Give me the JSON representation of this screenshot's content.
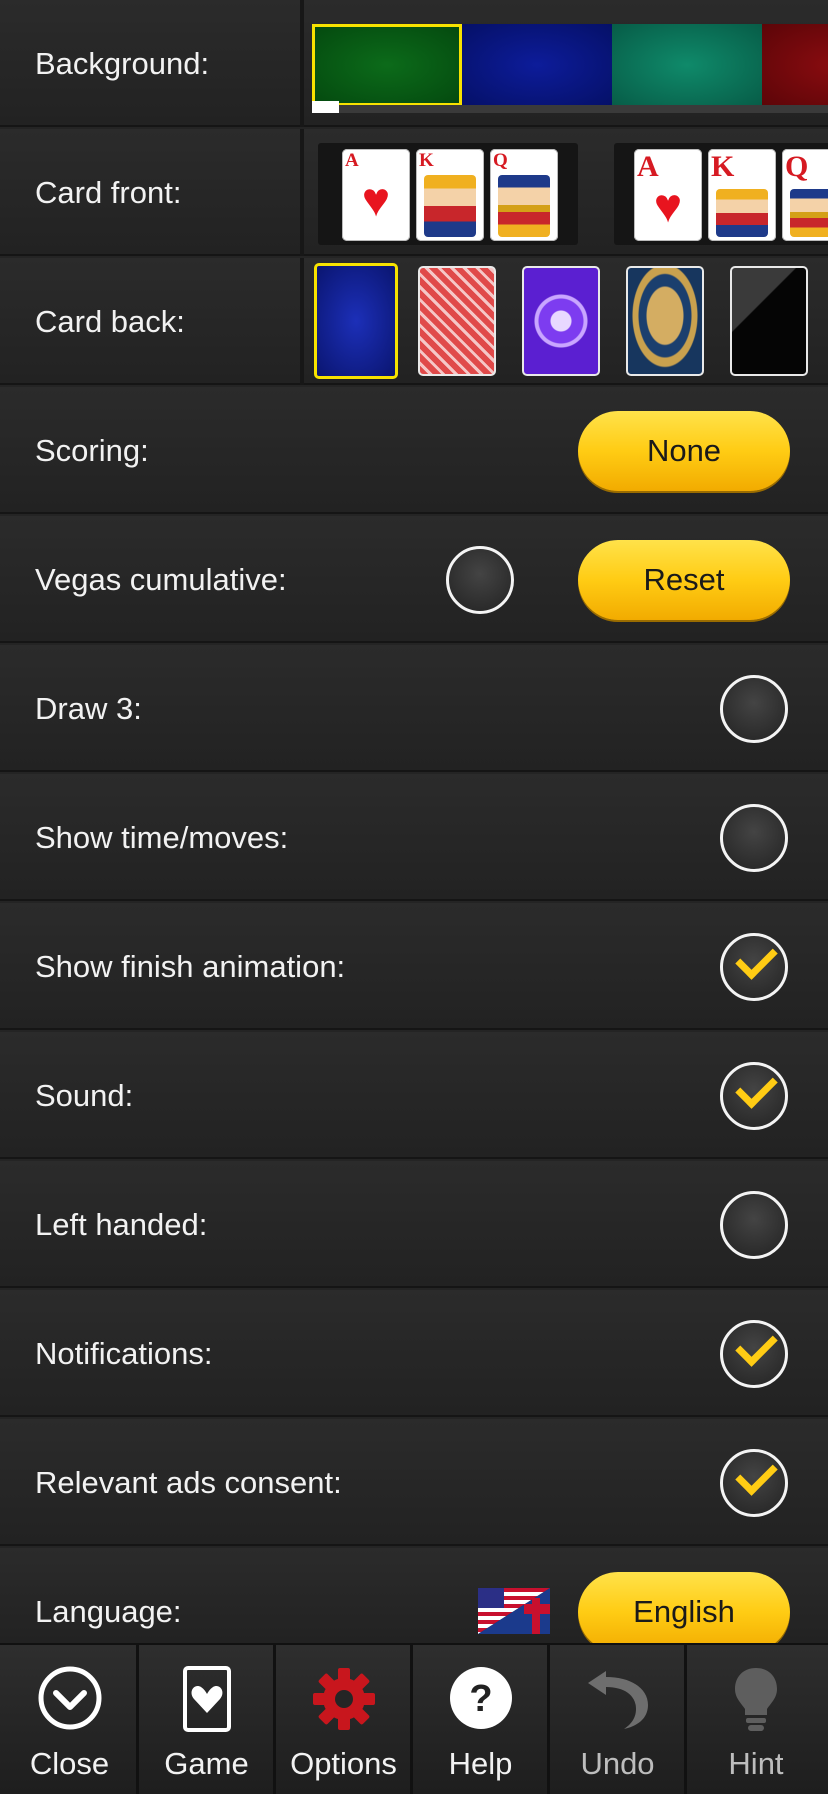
{
  "settings": {
    "background": {
      "label": "Background:",
      "colors": [
        "#0c6b1a",
        "#0d1c9a",
        "#0f8a6a",
        "#8a0c10"
      ]
    },
    "card_front": {
      "label": "Card front:",
      "ranks": [
        "A",
        "K",
        "Q"
      ]
    },
    "card_back": {
      "label": "Card back:"
    },
    "scoring": {
      "label": "Scoring:",
      "button": "None"
    },
    "vegas": {
      "label": "Vegas cumulative:",
      "button": "Reset",
      "checked": false
    },
    "draw3": {
      "label": "Draw 3:",
      "checked": false
    },
    "show_time": {
      "label": "Show time/moves:",
      "checked": false
    },
    "finish_anim": {
      "label": "Show finish animation:",
      "checked": true
    },
    "sound": {
      "label": "Sound:",
      "checked": true
    },
    "left_handed": {
      "label": "Left handed:",
      "checked": false
    },
    "notifications": {
      "label": "Notifications:",
      "checked": true
    },
    "ads": {
      "label": "Relevant ads consent:",
      "checked": true
    },
    "language": {
      "label": "Language:",
      "button": "English"
    }
  },
  "toolbar": {
    "close": "Close",
    "game": "Game",
    "options": "Options",
    "help": "Help",
    "undo": "Undo",
    "hint": "Hint"
  },
  "icons": {
    "close": "chevron-down-circle-icon",
    "game": "card-heart-icon",
    "options": "gear-icon",
    "help": "question-circle-icon",
    "undo": "undo-arrow-icon",
    "hint": "lightbulb-icon"
  },
  "colors": {
    "accent": "#ffcc14",
    "selected_border": "#f7e200",
    "gear": "#c8161d"
  }
}
